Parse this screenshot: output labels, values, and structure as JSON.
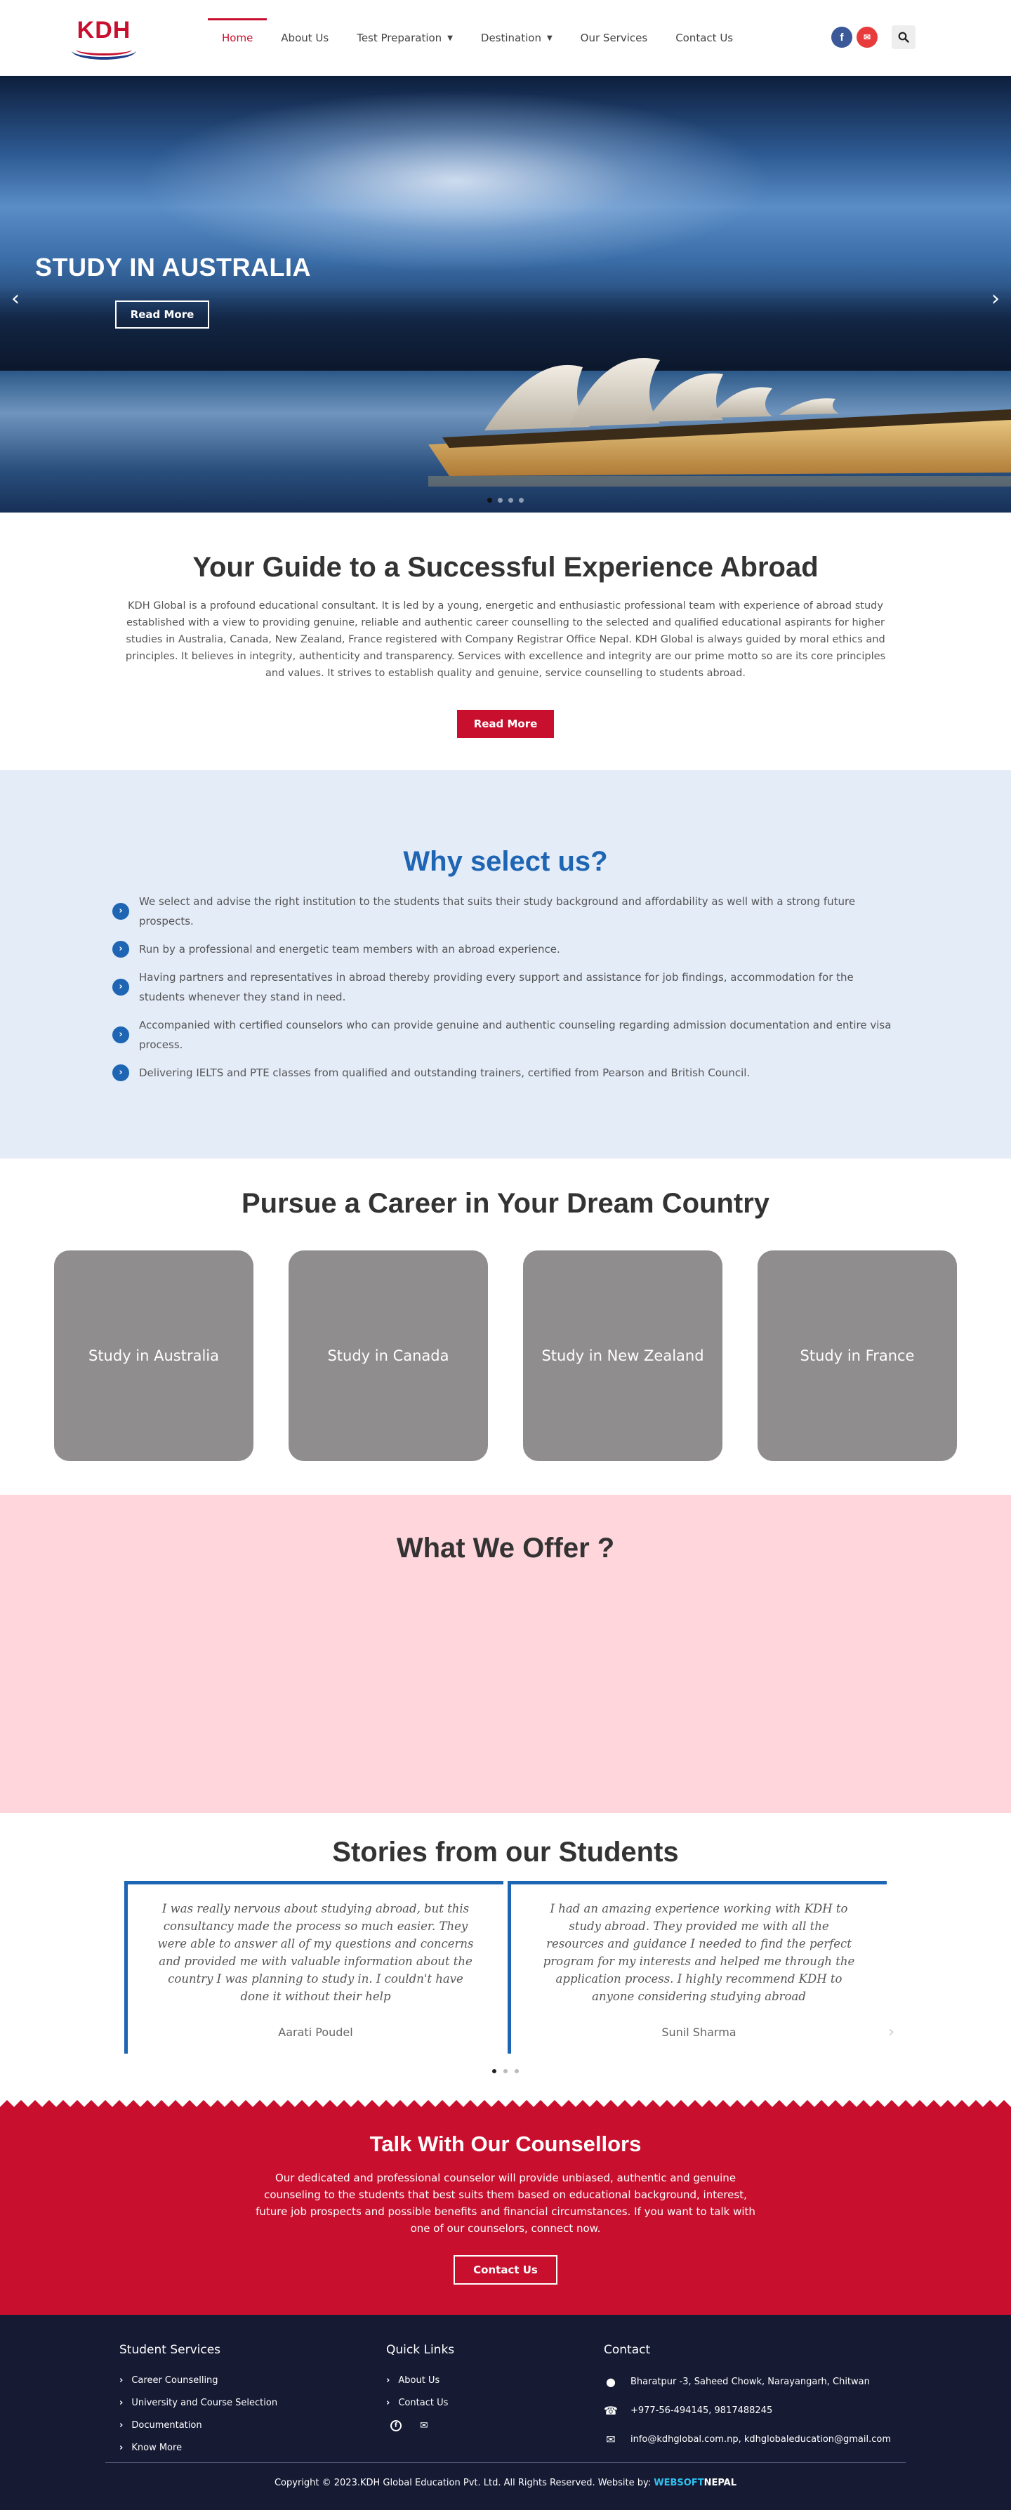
{
  "header": {
    "logo_text": "KDH",
    "nav": [
      {
        "label": "Home"
      },
      {
        "label": "About Us"
      },
      {
        "label": "Test Preparation"
      },
      {
        "label": "Destination"
      },
      {
        "label": "Our Services"
      },
      {
        "label": "Contact Us"
      }
    ],
    "icons": [
      "facebook-icon",
      "mail-icon",
      "search-icon"
    ]
  },
  "hero": {
    "title": "STUDY IN AUSTRALIA",
    "button": "Read More",
    "arrow_left": "‹",
    "arrow_right": "›",
    "slide_count": 4,
    "active_slide": 1
  },
  "guide": {
    "title": "Your Guide to a Successful Experience Abroad",
    "text": "KDH Global is a profound educational consultant. It is led by a young, energetic and enthusiastic professional team with experience of abroad study established with a view to providing genuine, reliable and authentic career counselling to the selected and qualified educational aspirants for higher studies in Australia, Canada, New Zealand, France registered with Company Registrar Office Nepal. KDH Global is always guided by moral ethics and principles. It believes in integrity, authenticity and transparency. Services with excellence and integrity are our prime motto so are its core principles and values. It strives to establish quality and genuine, service counselling to students abroad.",
    "button": "Read More"
  },
  "why": {
    "title": "Why select us?",
    "items": [
      "We select and advise the right institution to the students that suits their study background and affordability as well with a strong future prospects.",
      "Run by a professional and energetic team members with an abroad experience.",
      "Having partners and representatives in abroad thereby providing every support and assistance for job findings, accommodation for the students whenever they stand in need.",
      "Accompanied with certified counselors who can provide genuine and authentic counseling regarding admission documentation and entire visa process.",
      "Delivering IELTS and PTE classes from qualified and outstanding trainers, certified from Pearson and British Council."
    ]
  },
  "pursue": {
    "title": "Pursue a Career in Your Dream Country",
    "cards": [
      "Study in Australia",
      "Study in Canada",
      "Study in New Zealand",
      "Study in France"
    ]
  },
  "offer": {
    "title": "What We Offer ?"
  },
  "stories": {
    "title": "Stories from our Students",
    "testimonials": [
      {
        "quote": "I was really nervous about studying abroad, but this consultancy made the process so much easier. They were able to answer all of my questions and concerns and provided me with valuable information about the country I was planning to study in. I couldn't have done it without their help",
        "name": "Aarati Poudel"
      },
      {
        "quote": "I had an amazing experience working with KDH to study abroad. They provided me with all the resources and guidance I needed to find the perfect program for my interests and helped me through the application process. I highly recommend KDH to anyone considering studying abroad",
        "name": "Sunil Sharma"
      }
    ],
    "next_arrow": "›"
  },
  "talk": {
    "title": "Talk With Our Counsellors",
    "text": "Our dedicated and professional counselor will provide unbiased, authentic and genuine counseling to the students that best suits them based on educational background, interest, future job prospects and possible benefits and financial circumstances. If you want to talk with one of our counselors, connect now.",
    "button": "Contact Us"
  },
  "footer": {
    "student_services": {
      "title": "Student Services",
      "links": [
        "Career Counselling",
        "University and Course Selection",
        "Documentation",
        "Know More"
      ]
    },
    "quick_links": {
      "title": "Quick Links",
      "links": [
        "About Us",
        "Contact Us"
      ]
    },
    "contact": {
      "title": "Contact",
      "address": "Bharatpur -3, Saheed Chowk, Narayangarh, Chitwan",
      "phone": "+977-56-494145, 9817488245",
      "email": "info@kdhglobal.com.np, kdhglobaleducation@gmail.com"
    },
    "copyright": "Copyright © 2023.KDH Global Education Pvt. Ltd. All Rights Reserved. Website by:",
    "brand_a": "WEBSOFT",
    "brand_b": "NEPAL"
  },
  "colors": {
    "brand_red": "#c8102e",
    "brand_blue": "#1e65b3",
    "why_bg": "#e4ecf8",
    "offer_bg": "#ffd6dc",
    "footer_bg": "#161a33",
    "card_gray": "#8f8d8d"
  }
}
